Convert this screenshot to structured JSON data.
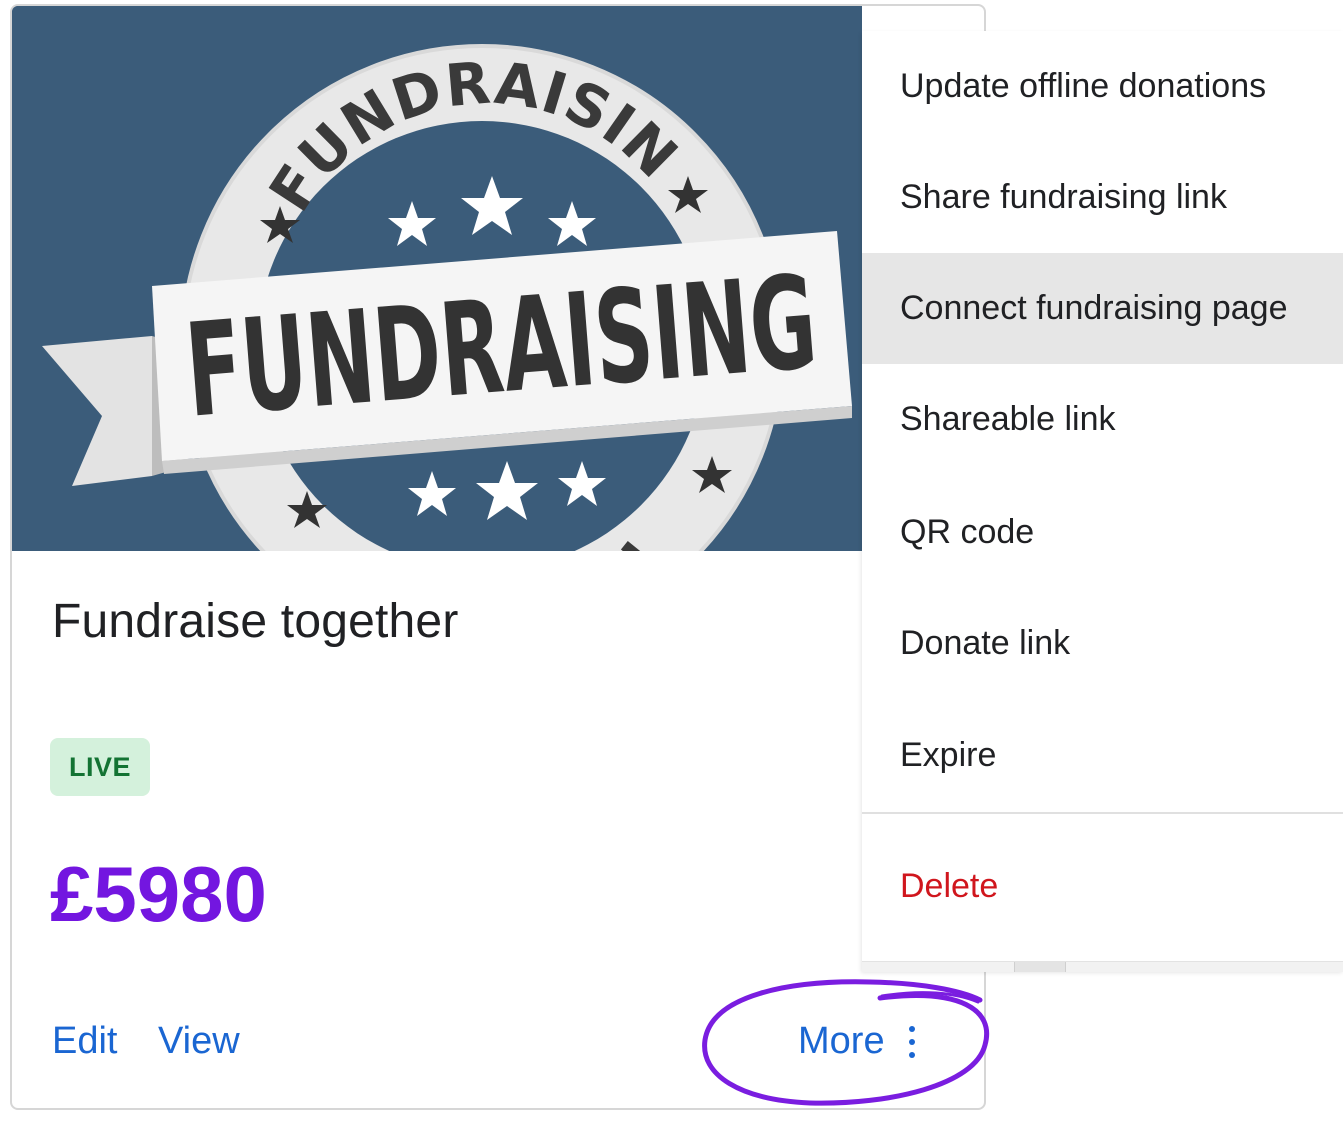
{
  "card": {
    "image_banner_text": "FUNDRAISING",
    "image_ring_text": "FUNDRAISING",
    "title": "Fundraise together",
    "status_badge": "LIVE",
    "amount": "£5980",
    "actions": {
      "edit": "Edit",
      "view": "View",
      "more": "More"
    }
  },
  "menu": {
    "items": [
      {
        "label": "Update offline donations"
      },
      {
        "label": "Share fundraising link"
      },
      {
        "label": "Connect fundraising page",
        "highlighted": true
      },
      {
        "label": "Shareable link"
      },
      {
        "label": "QR code"
      },
      {
        "label": "Donate link"
      },
      {
        "label": "Expire"
      },
      {
        "label": "Delete",
        "danger": true
      }
    ]
  },
  "colors": {
    "image_background": "#3b5c7a",
    "link": "#1a66d2",
    "amount": "#7316e0",
    "badge_bg": "#d4f1dc",
    "badge_text": "#137333",
    "danger": "#d0161d",
    "highlight": "#e6e6e6",
    "annotation_circle": "#7a1de0"
  }
}
